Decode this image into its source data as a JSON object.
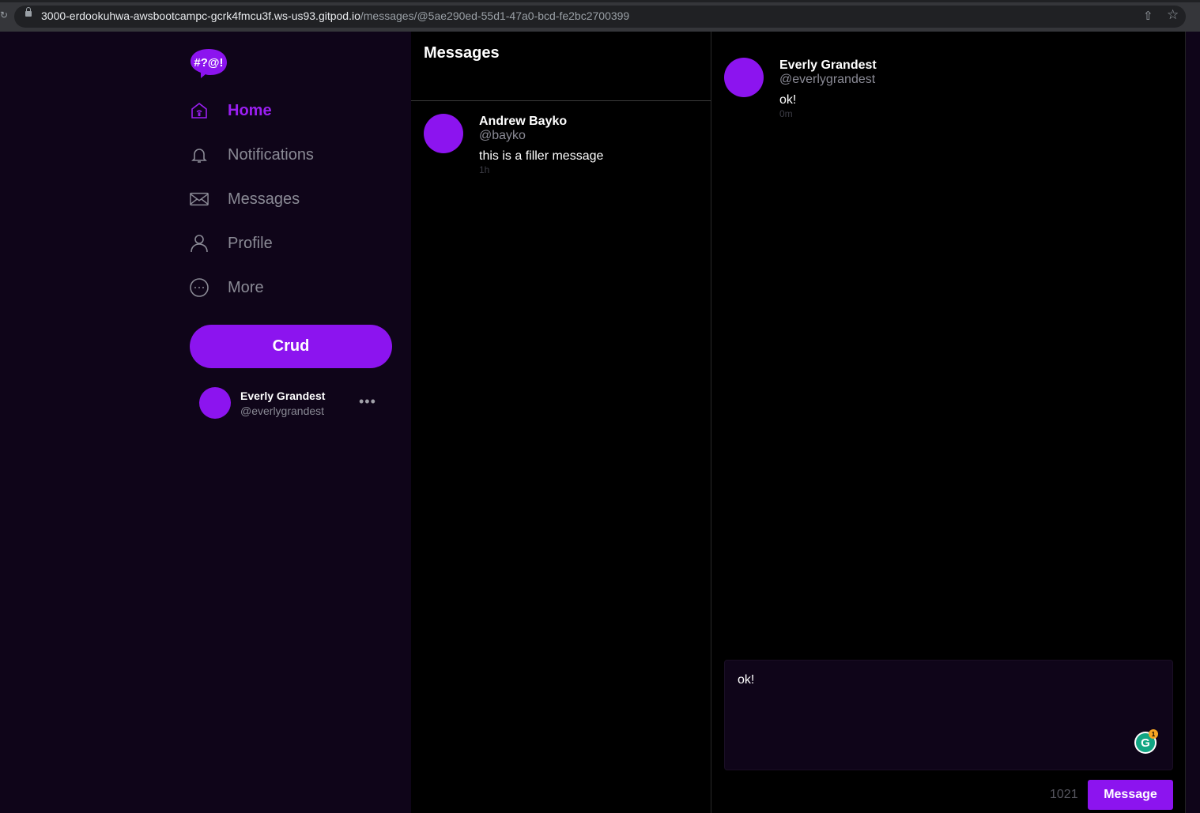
{
  "browser": {
    "url_host": "3000-erdookuhwa-awsbootcampc-gcrk4fmcu3f.ws-us93.gitpod.io",
    "url_path": "/messages/@5ae290ed-55d1-47a0-bcd-fe2bc2700399"
  },
  "sidebar": {
    "logo_text": "#?@!",
    "nav": [
      {
        "label": "Home",
        "icon": "home-icon",
        "active": true
      },
      {
        "label": "Notifications",
        "icon": "bell-icon",
        "active": false
      },
      {
        "label": "Messages",
        "icon": "envelope-icon",
        "active": false
      },
      {
        "label": "Profile",
        "icon": "person-icon",
        "active": false
      },
      {
        "label": "More",
        "icon": "more-circle-icon",
        "active": false
      }
    ],
    "crud_label": "Crud",
    "profile": {
      "name": "Everly Grandest",
      "handle": "@everlygrandest",
      "menu": "•••"
    }
  },
  "message_groups": {
    "title": "Messages",
    "items": [
      {
        "name": "Andrew Bayko",
        "handle": "@bayko",
        "message": "this is a filler message",
        "time": "1h"
      }
    ]
  },
  "conversation": {
    "messages": [
      {
        "name": "Everly Grandest",
        "handle": "@everlygrandest",
        "message": "ok!",
        "time": "0m"
      }
    ],
    "composer": {
      "value": "ok!",
      "grammarly_badge": "1",
      "char_count": "1021",
      "send_label": "Message"
    }
  },
  "colors": {
    "accent": "#8c14ef",
    "sidebar_bg": "#0f0519",
    "panel_bg": "#000000",
    "muted_text": "#8a8a95"
  }
}
